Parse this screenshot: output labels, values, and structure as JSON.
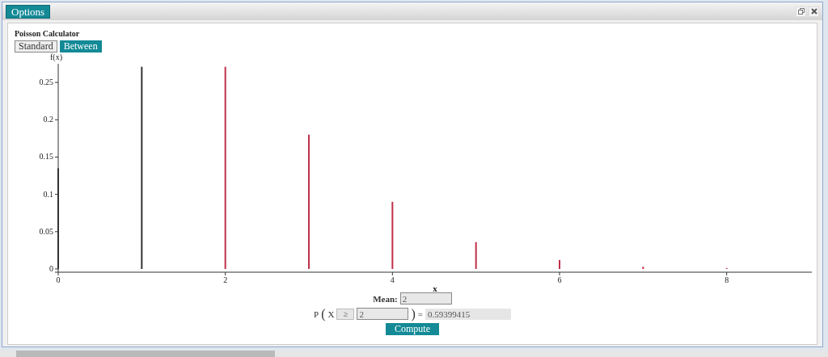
{
  "window": {
    "menu_button": "Options"
  },
  "calculator": {
    "title": "Poisson Calculator",
    "modes": [
      {
        "label": "Standard",
        "selected": false
      },
      {
        "label": "Between",
        "selected": true
      }
    ],
    "chart_data": {
      "type": "bar",
      "xlabel": "x",
      "ylabel": "f(x)",
      "x": [
        0,
        1,
        2,
        3,
        4,
        5,
        6,
        7,
        8
      ],
      "series": [
        {
          "color": "#333333",
          "values": [
            0.135,
            0.271,
            null,
            null,
            null,
            null,
            null,
            null,
            null
          ]
        },
        {
          "color": "#c0304a",
          "values": [
            null,
            null,
            0.271,
            0.18,
            0.09,
            0.036,
            0.012,
            0.003,
            0.001
          ]
        }
      ],
      "xlim": [
        0,
        9
      ],
      "ylim": [
        0,
        0.275
      ],
      "xticks": [
        0,
        2,
        4,
        6,
        8
      ],
      "yticks": [
        0,
        0.05,
        0.1,
        0.15,
        0.2,
        0.25
      ]
    },
    "mean_label": "Mean:",
    "mean_value": "2",
    "prob_prefix": "P",
    "open_paren": "(",
    "prob_var": "X",
    "operator": "≥",
    "x_value": "2",
    "close_paren": ")",
    "equals": "=",
    "result": "0.59399415",
    "compute_button": "Compute"
  }
}
